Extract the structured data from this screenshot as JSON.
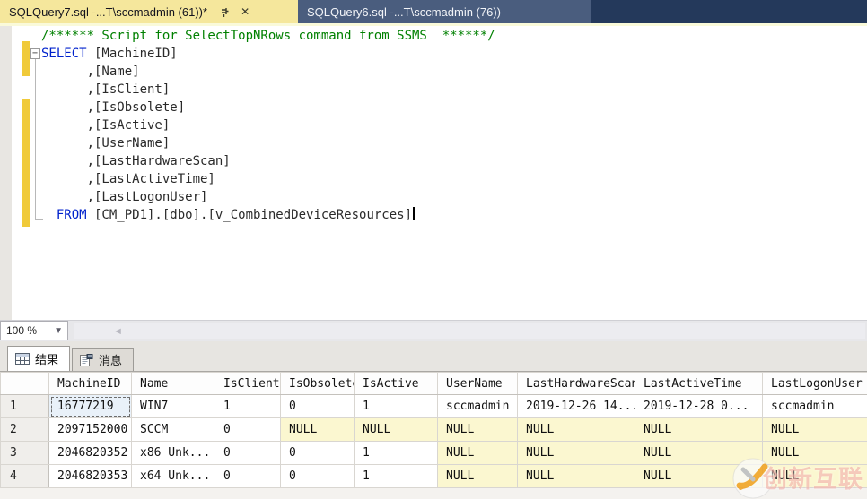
{
  "window": {
    "tabs": [
      {
        "label": "SQLQuery7.sql -...T\\sccmadmin (61))*",
        "state": "active-modified"
      },
      {
        "label": "SQLQuery6.sql -...T\\sccmadmin (76))",
        "state": "inactive"
      }
    ]
  },
  "editor": {
    "comment": "/****** Script for SelectTopNRows command from SSMS  ******/",
    "select_keyword": "SELECT",
    "select_first_column": " [MachineID]",
    "column_lines": [
      "      ,[Name]",
      "      ,[IsClient]",
      "      ,[IsObsolete]",
      "      ,[IsActive]",
      "      ,[UserName]",
      "      ,[LastHardwareScan]",
      "      ,[LastActiveTime]",
      "      ,[LastLogonUser]"
    ],
    "from_indent": "  ",
    "from_keyword": "FROM",
    "from_rest": " [CM_PD1].[dbo].[v_CombinedDeviceResources]",
    "fold_glyph": "−"
  },
  "statusbar": {
    "zoom_value": "100 %",
    "dropdown_glyph": "▼",
    "scroll_left_glyph": "◄"
  },
  "results_pane": {
    "results_tab_label": "结果",
    "messages_tab_label": "消息"
  },
  "grid": {
    "columns": [
      "MachineID",
      "Name",
      "IsClient",
      "IsObsolete",
      "IsActive",
      "UserName",
      "LastHardwareScan",
      "LastActiveTime",
      "LastLogonUser"
    ],
    "rows": [
      {
        "num": "1",
        "cells": [
          "16777219",
          "WIN7",
          "1",
          "0",
          "1",
          "sccmadmin",
          "2019-12-26 14...",
          "2019-12-28 0...",
          "sccmadmin"
        ]
      },
      {
        "num": "2",
        "cells": [
          "2097152000",
          "SCCM",
          "0",
          "NULL",
          "NULL",
          "NULL",
          "NULL",
          "NULL",
          "NULL"
        ]
      },
      {
        "num": "3",
        "cells": [
          "2046820352",
          "x86 Unk...",
          "0",
          "0",
          "1",
          "NULL",
          "NULL",
          "NULL",
          "NULL"
        ]
      },
      {
        "num": "4",
        "cells": [
          "2046820353",
          "x64 Unk...",
          "0",
          "0",
          "1",
          "NULL",
          "NULL",
          "NULL",
          "NULL"
        ]
      }
    ],
    "selected_cell": {
      "row": 1,
      "column": "MachineID"
    }
  },
  "watermark": {
    "text": "创新互联"
  },
  "colors": {
    "tabbar_bg": "#24395b",
    "active_tab_bg": "#f5e79c",
    "inactive_tab_bg": "#4a5d7e",
    "keyword_blue": "#0022cc",
    "comment_green": "#008000",
    "change_bar_yellow": "#f0ca3a",
    "null_cell_yellow": "#fbf7d0",
    "selected_cell_blue": "#e9f1f9"
  }
}
